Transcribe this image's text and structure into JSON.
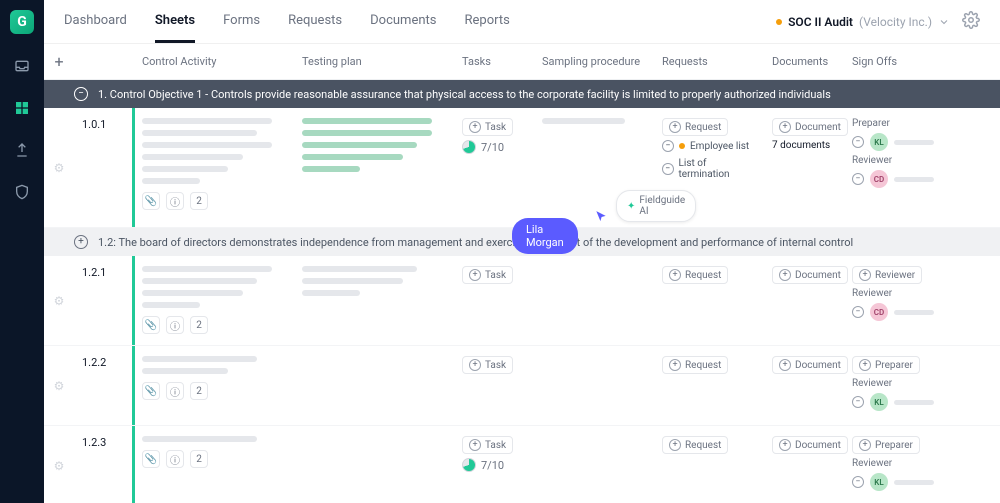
{
  "logo_letter": "G",
  "nav": {
    "tabs": [
      "Dashboard",
      "Sheets",
      "Forms",
      "Requests",
      "Documents",
      "Reports"
    ],
    "active_index": 1
  },
  "header": {
    "audit_name": "SOC II Audit",
    "audit_org": "(Velocity Inc.)"
  },
  "columns": {
    "num": "",
    "activity": "Control Activity",
    "testing": "Testing plan",
    "tasks": "Tasks",
    "sampling": "Sampling procedure",
    "requests": "Requests",
    "documents": "Documents",
    "signoffs": "Sign Offs"
  },
  "section1": {
    "text": "1. Control Objective 1 - Controls provide reasonable assurance that physical access to the corporate facility is limited to properly authorized individuals"
  },
  "row101": {
    "num": "1.0.1",
    "task_label": "Task",
    "task_progress": "7/10",
    "request_label": "Request",
    "req1": "Employee list",
    "req2": "List of termination",
    "document_label": "Document",
    "document_count": "7 documents",
    "preparer_label": "Preparer",
    "preparer_initials": "KL",
    "reviewer_label": "Reviewer",
    "reviewer_initials": "CD",
    "count_badge": "2"
  },
  "ai_chip": "Fieldguide AI",
  "user_chip": "Lila Morgan",
  "subsection12": {
    "text": "1.2: The board of directors demonstrates independence from management and exercises oversight of the development and performance of internal control"
  },
  "row121": {
    "num": "1.2.1",
    "task_label": "Task",
    "request_label": "Request",
    "document_label": "Document",
    "reviewer_btn": "Reviewer",
    "reviewer_label": "Reviewer",
    "reviewer_initials": "CD",
    "count_badge": "2"
  },
  "row122": {
    "num": "1.2.2",
    "task_label": "Task",
    "request_label": "Request",
    "document_label": "Document",
    "preparer_btn": "Preparer",
    "reviewer_label": "Reviewer",
    "reviewer_initials": "KL",
    "count_badge": "2"
  },
  "row123": {
    "num": "1.2.3",
    "task_label": "Task",
    "task_progress": "7/10",
    "request_label": "Request",
    "document_label": "Document",
    "preparer_btn": "Preparer",
    "reviewer_label": "Reviewer",
    "count_badge": "2"
  }
}
